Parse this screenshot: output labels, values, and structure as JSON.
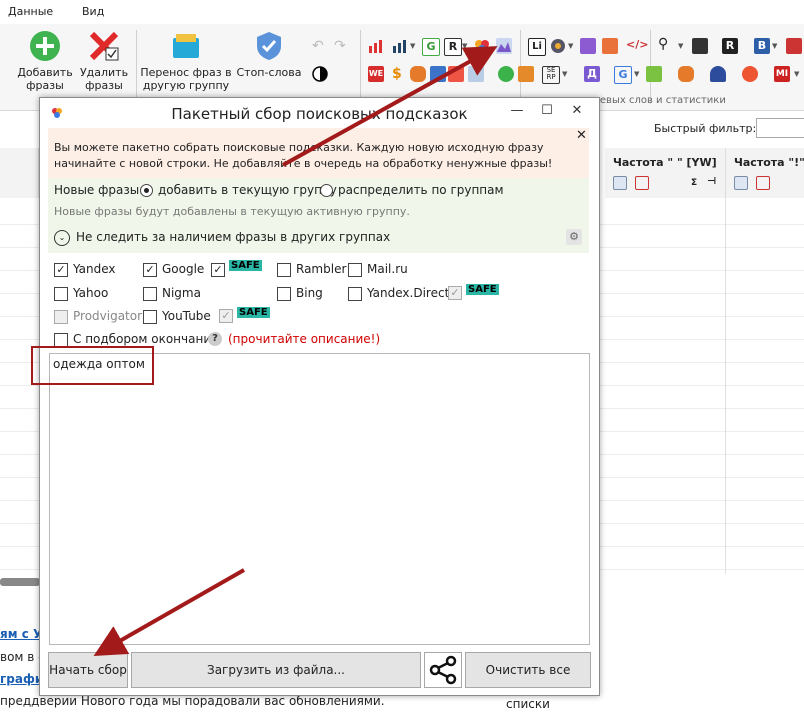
{
  "menubar": {
    "items": [
      "Данные",
      "Вид"
    ]
  },
  "ribbon": {
    "add_phrases": "Добавить\nфразы",
    "delete_phrases": "Удалить\nфразы",
    "move_phrases": "Перенос фраз в\nдругую группу",
    "stop_words": "Стоп-слова",
    "caption": "чевых слов и статистики"
  },
  "filter": {
    "label": "Быстрый фильтр:"
  },
  "columns": {
    "freq_quote": "Частота \" \" [YW]",
    "freq_excl": "Частота \"!\" [YW",
    "sigma": "Σ"
  },
  "news": {
    "line1": "ям с Ук",
    "line2": "вом в с",
    "line3": "график",
    "line4": "преддверии Нового года мы порадовали вас обновлениями."
  },
  "dialog": {
    "title": "Пакетный сбор поисковых подсказок",
    "info": "Вы можете пакетно собрать поисковые подсказки. Каждую новую исходную фразу начинайте с новой строки. Не добавляйте в очередь на обработку ненужные фразы!",
    "new_phrases_label": "Новые фразы:",
    "radio_current": "добавить в текущую группу",
    "radio_distribute": "распределить по группам",
    "new_phrases_hint": "Новые фразы будут добавлены в текущую активную группу.",
    "track_label": "Не следить за наличием фразы в других группах",
    "sources": {
      "yandex": "Yandex",
      "google": "Google",
      "rambler": "Rambler",
      "mailru": "Mail.ru",
      "yahoo": "Yahoo",
      "nigma": "Nigma",
      "bing": "Bing",
      "yandex_direct": "Yandex.Direct",
      "prodvigator": "Prodvigator",
      "youtube": "YouTube"
    },
    "safe_badge": "SAFE",
    "endings_label": "С подбором окончаний",
    "read_desc": "(прочитайте описание!)",
    "textarea_value": "одежда оптом",
    "start_button": "Начать сбор",
    "load_button": "Загрузить из файла...",
    "clear_button": "Очистить все списки"
  },
  "colors": {
    "info_bg": "#fdeee6",
    "green_bg": "#f0f7ea",
    "safe_badge": "#2ab5a5",
    "annotation_red": "#a31a1a",
    "warning_text": "#d00000"
  }
}
